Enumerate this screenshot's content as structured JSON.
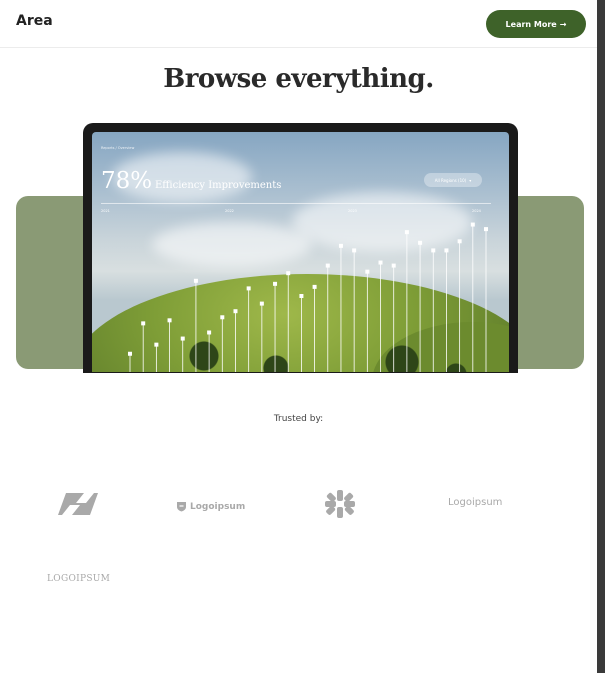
{
  "header": {
    "brand": "Area",
    "cta_label": "Learn More",
    "cta_arrow": "→"
  },
  "hero": {
    "title": "Browse everything."
  },
  "dashboard": {
    "breadcrumb": "Reports / Overview",
    "stat_value": "78%",
    "stat_label": "Efficiency Improvements",
    "region_select": "All Regions (10)",
    "region_caret": "▾",
    "years": [
      "2021",
      "2022",
      "2023",
      "2024"
    ],
    "stem_levels": [
      0.12,
      0.32,
      0.18,
      0.34,
      0.22,
      0.6,
      0.26,
      0.36,
      0.4,
      0.55,
      0.45,
      0.58,
      0.65,
      0.5,
      0.56,
      0.7,
      0.83,
      0.8,
      0.66,
      0.72,
      0.7,
      0.92,
      0.85,
      0.8,
      0.8,
      0.86,
      0.97,
      0.94
    ]
  },
  "trusted": {
    "label": "Trusted by:",
    "logos": [
      "Logoipsum",
      "Logoipsum",
      "LOGOIPSUM"
    ]
  },
  "colors": {
    "accent": "#3e6229",
    "band": "#8a9a75",
    "logo_gray": "#a9a9a9"
  }
}
